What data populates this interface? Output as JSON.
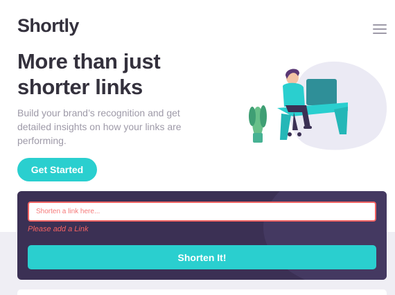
{
  "header": {
    "logo": "Shortly",
    "menu_icon": "hamburger-menu-icon"
  },
  "hero": {
    "title": "More than just shorter links",
    "subtitle": "Build your brand’s recognition and get detailed insights on how your links are performing.",
    "cta_label": "Get Started",
    "illustration": "person-working-at-desk-illustration"
  },
  "shorten": {
    "input_placeholder": "Shorten a link here...",
    "input_value": "",
    "error": "Please add a Link",
    "button_label": "Shorten It!"
  },
  "colors": {
    "cyan": "#2acfcf",
    "dark_violet": "#3b3054",
    "red": "#f46262",
    "very_dark_blue": "#34313d",
    "grayish_violet": "#9e9aa8",
    "light_gray_bg": "#efeef4"
  }
}
